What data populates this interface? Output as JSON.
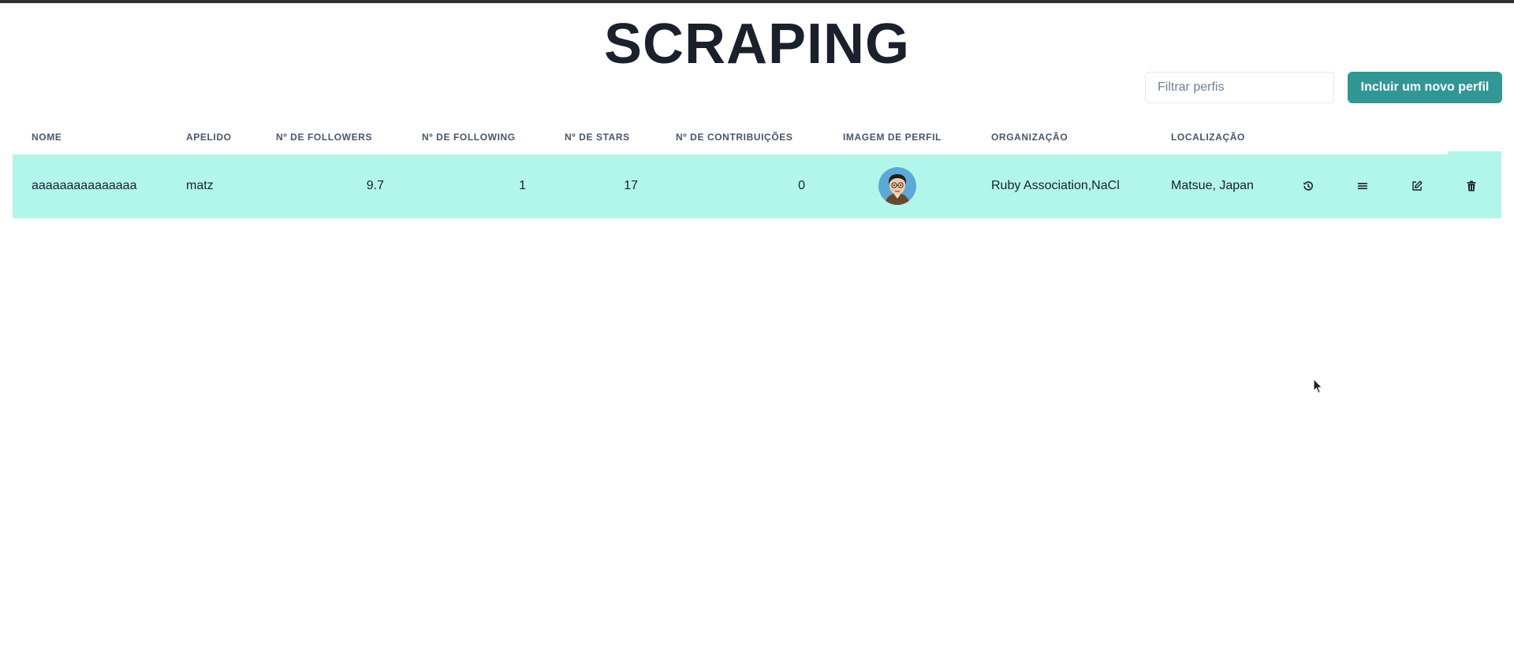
{
  "page": {
    "title": "SCRAPING"
  },
  "toolbar": {
    "filter_placeholder": "Filtrar perfis",
    "filter_value": "",
    "add_button_label": "Incluir um novo perfil"
  },
  "table": {
    "columns": [
      "NOME",
      "APELIDO",
      "Nº DE FOLLOWERS",
      "Nº DE FOLLOWING",
      "Nº DE STARS",
      "Nº DE CONTRIBUIÇÕES",
      "IMAGEM DE PERFIL",
      "ORGANIZAÇÃO",
      "LOCALIZAÇÃO"
    ],
    "rows": [
      {
        "nome": "aaaaaaaaaaaaaaa",
        "apelido": "matz",
        "followers": "9.7",
        "following": "1",
        "stars": "17",
        "contribuicoes": "0",
        "imagem": "avatar",
        "organizacao": "Ruby Association,NaCl",
        "localizacao": "Matsue, Japan",
        "actions": [
          "history-icon",
          "menu-icon",
          "edit-icon",
          "trash-icon"
        ]
      }
    ]
  },
  "colors": {
    "title": "#1a202c",
    "accent": "#319795",
    "row_highlight": "#b2f5ea",
    "header_text": "#4a5568"
  }
}
